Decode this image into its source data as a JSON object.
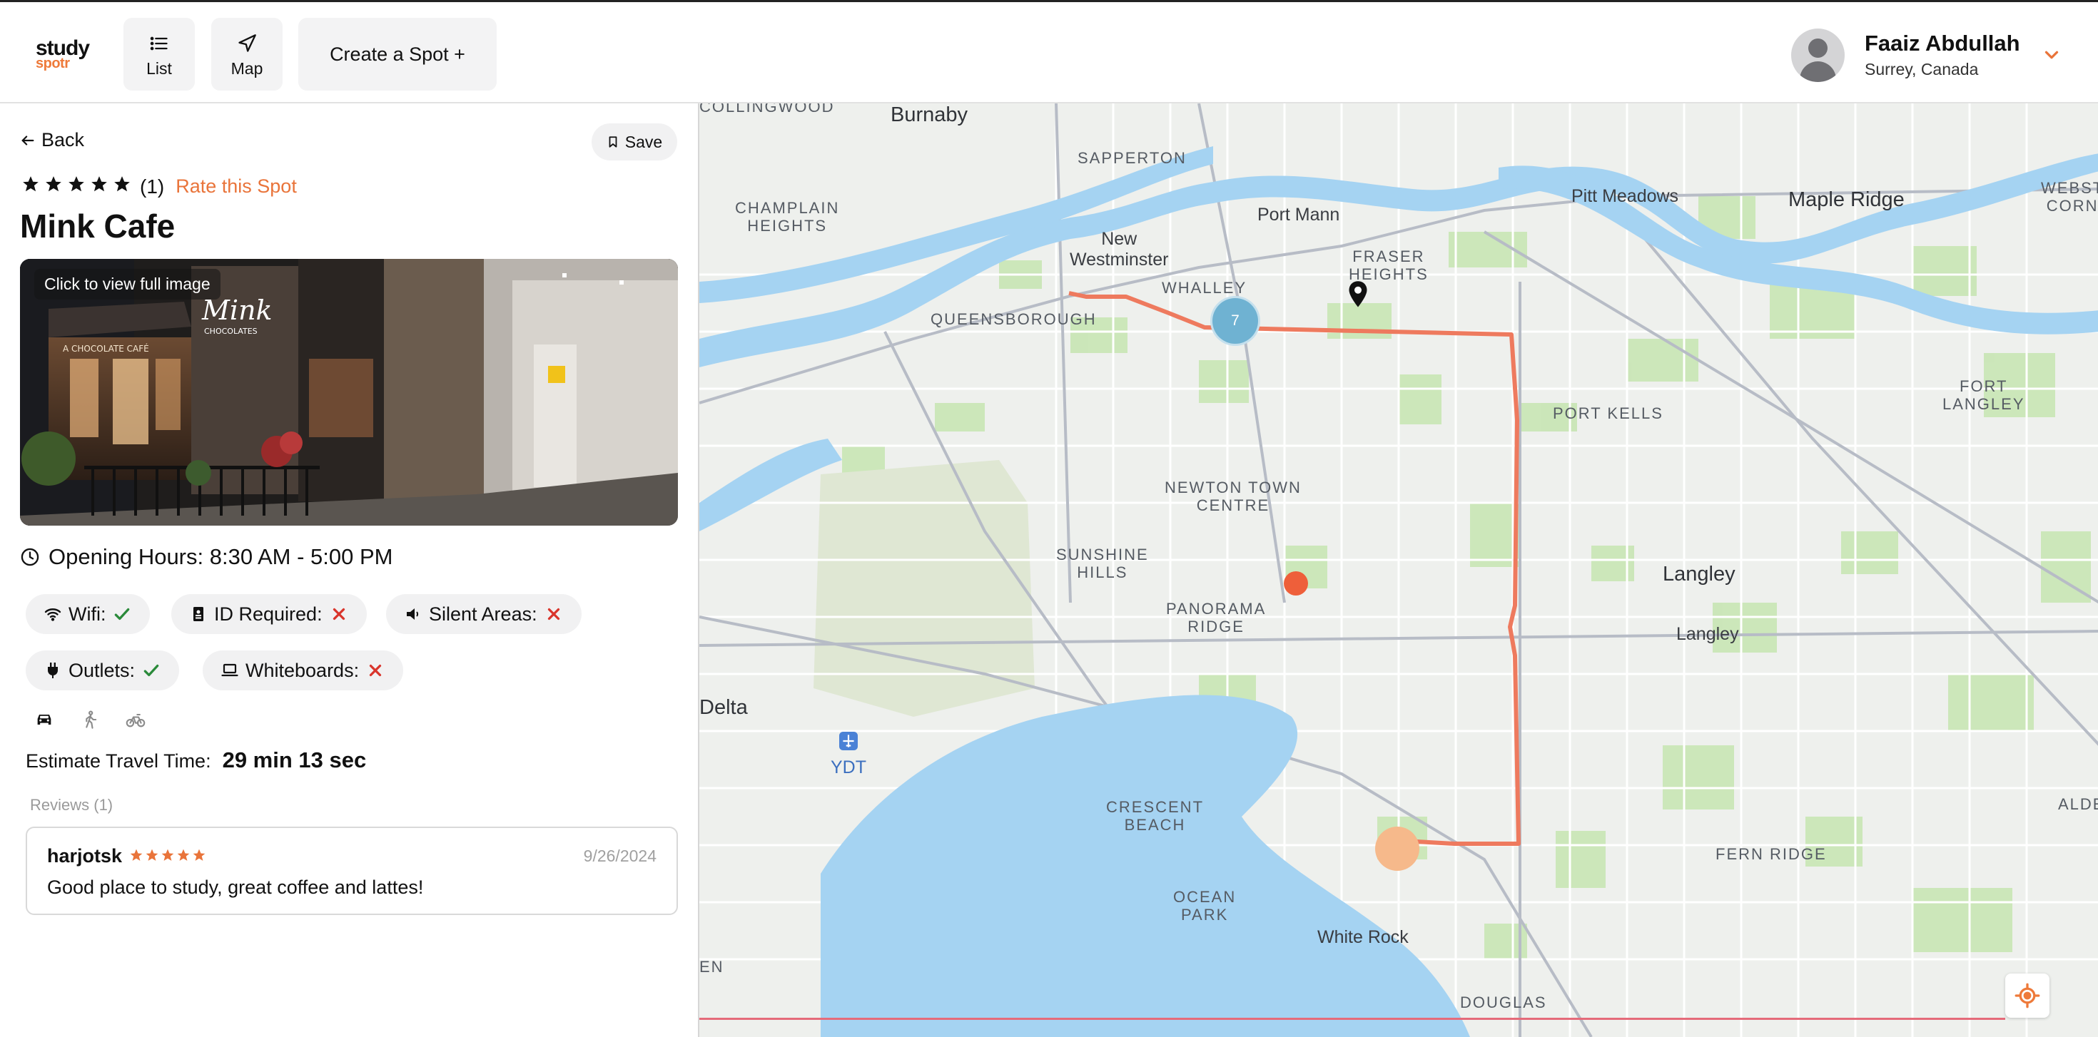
{
  "brand": {
    "line1": "study",
    "line2": "spotr"
  },
  "nav": {
    "list_label": "List",
    "map_label": "Map",
    "create_label": "Create a Spot +"
  },
  "user": {
    "name": "Faaiz Abdullah",
    "location": "Surrey, Canada"
  },
  "spot": {
    "back_label": "Back",
    "save_label": "Save",
    "rating_stars": 5,
    "rating_count": "(1)",
    "rate_label": "Rate this Spot",
    "name": "Mink Cafe",
    "image_caption": "Click to view full image",
    "opening_hours": "Opening Hours: 8:30 AM - 5:00 PM",
    "amenities": {
      "wifi": {
        "label": "Wifi:",
        "available": true
      },
      "id_required": {
        "label": "ID Required:",
        "available": false
      },
      "silent_areas": {
        "label": "Silent Areas:",
        "available": false
      },
      "outlets": {
        "label": "Outlets:",
        "available": true
      },
      "whiteboards": {
        "label": "Whiteboards:",
        "available": false
      }
    },
    "travel": {
      "modes": [
        "car-icon",
        "walk-icon",
        "bike-icon"
      ],
      "active_mode": "car",
      "label": "Estimate Travel Time:",
      "value": "29 min 13 sec"
    },
    "reviews_heading": "Reviews (1)",
    "reviews": [
      {
        "author": "harjotsk",
        "stars": 5,
        "date": "9/26/2024",
        "text": "Good place to study, great coffee and lattes!"
      }
    ]
  },
  "map": {
    "cluster_count": "7",
    "labels": {
      "collingwood": "COLLINGWOOD",
      "burnaby": "Burnaby",
      "sapperton": "SAPPERTON",
      "champlain": "CHAMPLAIN\nHEIGHTS",
      "new_westminster": "New\nWestminster",
      "port_mann": "Port Mann",
      "fraser_heights": "FRASER\nHEIGHTS",
      "pitt_meadows": "Pitt Meadows",
      "maple_ridge": "Maple Ridge",
      "webster_corner": "WEBSTER\nCORNER",
      "whalley": "WHALLEY",
      "queensborough": "QUEENSBOROUGH",
      "fort_langley": "FORT\nLANGLEY",
      "port_kells": "PORT KELLS",
      "newton": "NEWTON TOWN\nCENTRE",
      "sunshine_hills": "SUNSHINE\nHILLS",
      "panorama_ridge": "PANORAMA\nRIDGE",
      "langley_city": "Langley",
      "langley_town": "Langley",
      "delta": "Delta",
      "ydt": "YDT",
      "crescent_beach": "CRESCENT\nBEACH",
      "ocean_park": "OCEAN\nPARK",
      "white_rock": "White Rock",
      "fern_ridge": "FERN RIDGE",
      "alde": "ALDE",
      "douglas": "DOUGLAS",
      "en": "EN"
    }
  },
  "colors": {
    "accent": "#e9743a",
    "route": "#ee7a5e",
    "water": "#a5d3f2",
    "park": "#c8e6b4",
    "cluster": "#6fb2d2",
    "check": "#2a8a3a",
    "cross": "#d9342b"
  }
}
